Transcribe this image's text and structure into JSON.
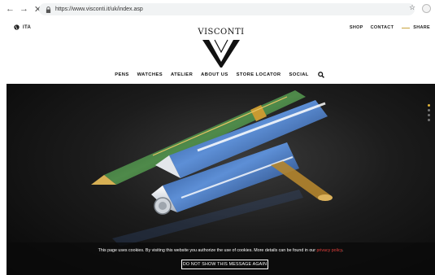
{
  "browser": {
    "back_icon": "arrow-left-icon",
    "forward_icon": "arrow-right-icon",
    "stop_icon": "close-icon",
    "url": "https://www.visconti.it/uk/index.asp"
  },
  "header": {
    "language": "ITA",
    "top_links": [
      "SHOP",
      "CONTACT",
      "SHARE"
    ],
    "logo_text": "VISCONTI"
  },
  "main_nav": {
    "items": [
      "PENS",
      "WATCHES",
      "ATELIER",
      "ABOUT US",
      "STORE LOCATOR",
      "SOCIAL"
    ]
  },
  "hero": {
    "slide_count": 4,
    "active_slide": 1,
    "accent": "#e2b53b"
  },
  "cookie_bar": {
    "message": "This page uses cookies. By visiting this website you authorize the use of cookies. More details can be found in our ",
    "policy_link": "privacy policy",
    "policy_suffix": ".",
    "button_label": "DO NOT SHOW THIS MESSAGE AGAIN"
  },
  "colors": {
    "gold": "#c8a23c",
    "policy_red": "#e2403c"
  }
}
